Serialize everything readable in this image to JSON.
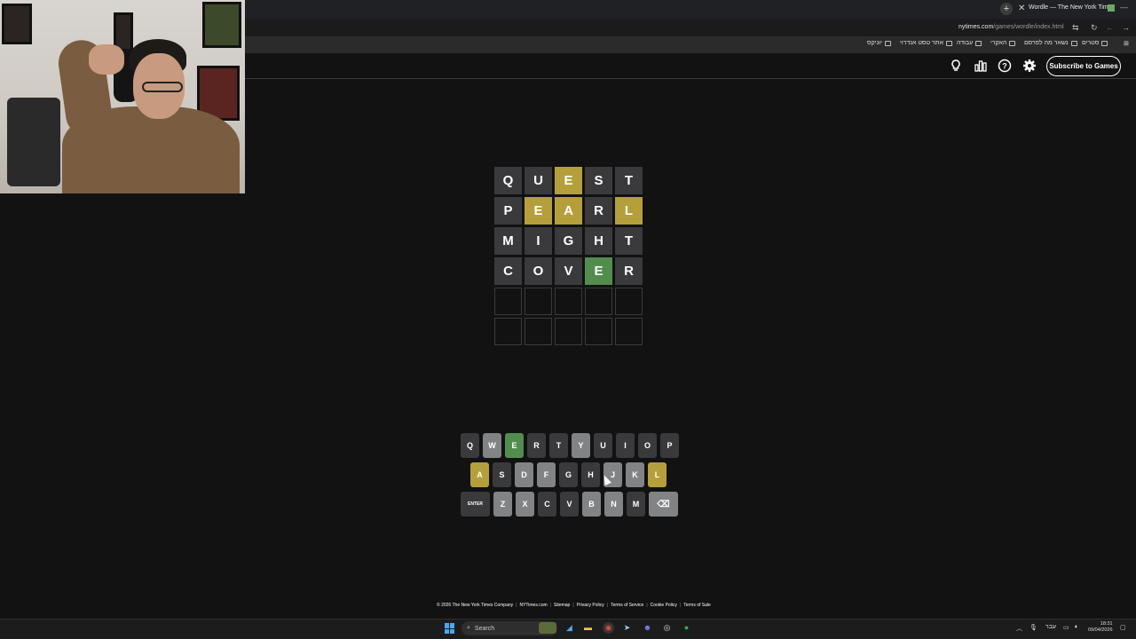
{
  "browser": {
    "tab_title": "Wordle — The New York Times",
    "url_domain": "nytimes.com",
    "url_path": "/games/wordle/index.html",
    "bookmarks": [
      "סטרים",
      "נשאר מה לפרסם",
      "האקרי",
      "עבודה",
      "אתר טסט אנדרוי",
      "יוניקס"
    ]
  },
  "header": {
    "subscribe_label": "Subscribe to Games",
    "icons": [
      "lightbulb-icon",
      "stats-icon",
      "help-icon",
      "settings-icon"
    ]
  },
  "board": {
    "rows": [
      [
        {
          "l": "Q",
          "s": "absent"
        },
        {
          "l": "U",
          "s": "absent"
        },
        {
          "l": "E",
          "s": "present"
        },
        {
          "l": "S",
          "s": "absent"
        },
        {
          "l": "T",
          "s": "absent"
        }
      ],
      [
        {
          "l": "P",
          "s": "absent"
        },
        {
          "l": "E",
          "s": "present"
        },
        {
          "l": "A",
          "s": "present"
        },
        {
          "l": "R",
          "s": "absent"
        },
        {
          "l": "L",
          "s": "present"
        }
      ],
      [
        {
          "l": "M",
          "s": "absent"
        },
        {
          "l": "I",
          "s": "absent"
        },
        {
          "l": "G",
          "s": "absent"
        },
        {
          "l": "H",
          "s": "absent"
        },
        {
          "l": "T",
          "s": "absent"
        }
      ],
      [
        {
          "l": "C",
          "s": "absent"
        },
        {
          "l": "O",
          "s": "absent"
        },
        {
          "l": "V",
          "s": "absent"
        },
        {
          "l": "E",
          "s": "correct"
        },
        {
          "l": "R",
          "s": "absent"
        }
      ],
      [
        {
          "l": "",
          "s": "empty"
        },
        {
          "l": "",
          "s": "empty"
        },
        {
          "l": "",
          "s": "empty"
        },
        {
          "l": "",
          "s": "empty"
        },
        {
          "l": "",
          "s": "empty"
        }
      ],
      [
        {
          "l": "",
          "s": "empty"
        },
        {
          "l": "",
          "s": "empty"
        },
        {
          "l": "",
          "s": "empty"
        },
        {
          "l": "",
          "s": "empty"
        },
        {
          "l": "",
          "s": "empty"
        }
      ]
    ]
  },
  "keyboard": {
    "row1": [
      {
        "k": "Q",
        "s": "absent"
      },
      {
        "k": "W",
        "s": "unused"
      },
      {
        "k": "E",
        "s": "correct"
      },
      {
        "k": "R",
        "s": "absent"
      },
      {
        "k": "T",
        "s": "absent"
      },
      {
        "k": "Y",
        "s": "unused"
      },
      {
        "k": "U",
        "s": "absent"
      },
      {
        "k": "I",
        "s": "absent"
      },
      {
        "k": "O",
        "s": "absent"
      },
      {
        "k": "P",
        "s": "absent"
      }
    ],
    "row2": [
      {
        "k": "A",
        "s": "present"
      },
      {
        "k": "S",
        "s": "absent"
      },
      {
        "k": "D",
        "s": "unused"
      },
      {
        "k": "F",
        "s": "unused"
      },
      {
        "k": "G",
        "s": "absent"
      },
      {
        "k": "H",
        "s": "absent"
      },
      {
        "k": "J",
        "s": "unused"
      },
      {
        "k": "K",
        "s": "unused"
      },
      {
        "k": "L",
        "s": "present"
      }
    ],
    "row3": [
      {
        "k": "ENTER",
        "s": "wide"
      },
      {
        "k": "Z",
        "s": "unused"
      },
      {
        "k": "X",
        "s": "unused"
      },
      {
        "k": "C",
        "s": "absent"
      },
      {
        "k": "V",
        "s": "absent"
      },
      {
        "k": "B",
        "s": "unused"
      },
      {
        "k": "N",
        "s": "unused"
      },
      {
        "k": "M",
        "s": "absent"
      },
      {
        "k": "⌫",
        "s": "back"
      }
    ]
  },
  "footer": {
    "links": [
      "© 2026 The New York Times Company",
      "NYTimes.com",
      "Sitemap",
      "Privacy Policy",
      "Terms of Service",
      "Cookie Policy",
      "Terms of Sale"
    ]
  },
  "taskbar": {
    "search_label": "Search",
    "language": "עבר",
    "time": "18:31",
    "date": "09/04/2026"
  },
  "colors": {
    "absent": "#3a3a3c",
    "present": "#b59f3b",
    "correct": "#538d4e",
    "unused": "#818384",
    "background": "#121213"
  }
}
